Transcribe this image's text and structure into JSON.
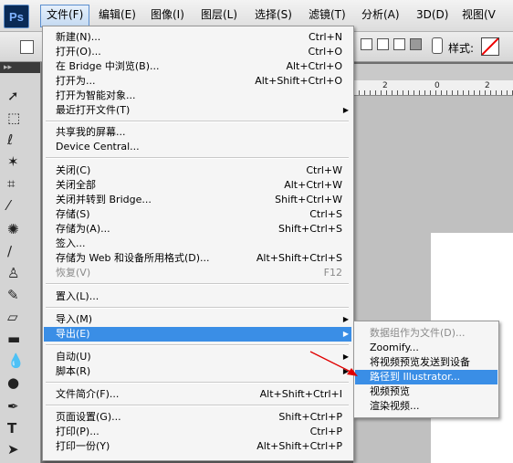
{
  "app": {
    "logo_text": "Ps"
  },
  "menubar": [
    {
      "label": "文件(F)",
      "active": true
    },
    {
      "label": "编辑(E)"
    },
    {
      "label": "图像(I)"
    },
    {
      "label": "图层(L)"
    },
    {
      "label": "选择(S)"
    },
    {
      "label": "滤镜(T)"
    },
    {
      "label": "分析(A)"
    },
    {
      "label": "3D(D)"
    },
    {
      "label": "视图(V"
    }
  ],
  "options_bar": {
    "style_label": "样式:"
  },
  "ruler": {
    "ticks": [
      "2",
      "0",
      "2"
    ]
  },
  "file_menu": [
    {
      "label": "新建(N)...",
      "shortcut": "Ctrl+N"
    },
    {
      "label": "打开(O)...",
      "shortcut": "Ctrl+O"
    },
    {
      "label": "在 Bridge 中浏览(B)...",
      "shortcut": "Alt+Ctrl+O"
    },
    {
      "label": "打开为...",
      "shortcut": "Alt+Shift+Ctrl+O"
    },
    {
      "label": "最近打开文件(T)",
      "submenu": true
    },
    {
      "label": "共享我的屏幕..."
    },
    {
      "label": "Device Central..."
    },
    {
      "label": "关闭(C)",
      "shortcut": "Ctrl+W"
    },
    {
      "label": "关闭全部",
      "shortcut": "Alt+Ctrl+W"
    },
    {
      "label": "关闭并转到 Bridge...",
      "shortcut": "Shift+Ctrl+W"
    },
    {
      "label": "存储(S)",
      "shortcut": "Ctrl+S"
    },
    {
      "label": "存储为(A)...",
      "shortcut": "Shift+Ctrl+S"
    },
    {
      "label": "签入..."
    },
    {
      "label": "存储为 Web 和设备所用格式(D)...",
      "shortcut": "Alt+Shift+Ctrl+S"
    },
    {
      "label": "恢复(V)",
      "shortcut": "F12",
      "disabled": true
    },
    {
      "label": "置入(L)..."
    },
    {
      "label": "导入(M)",
      "submenu": true
    },
    {
      "label": "导出(E)",
      "submenu": true,
      "highlighted": true
    },
    {
      "label": "自动(U)",
      "submenu": true
    },
    {
      "label": "脚本(R)",
      "submenu": true
    },
    {
      "label": "文件简介(F)...",
      "shortcut": "Alt+Shift+Ctrl+I"
    },
    {
      "label": "页面设置(G)...",
      "shortcut": "Shift+Ctrl+P"
    },
    {
      "label": "打印(P)...",
      "shortcut": "Ctrl+P"
    },
    {
      "label": "打印一份(Y)",
      "shortcut": "Alt+Shift+Ctrl+P"
    }
  ],
  "export_submenu": [
    {
      "label": "数据组作为文件(D)...",
      "disabled": true
    },
    {
      "label": "Zoomify..."
    },
    {
      "label": "将视频预览发送到设备"
    },
    {
      "label": "路径到 Illustrator...",
      "highlighted": true
    },
    {
      "label": "视频预览"
    },
    {
      "label": "渲染视频..."
    }
  ],
  "colors": {
    "highlight": "#3a8ee6",
    "annotation_arrow": "#e00000"
  }
}
